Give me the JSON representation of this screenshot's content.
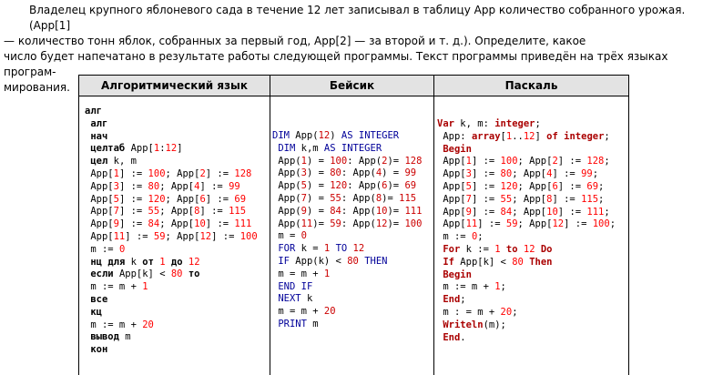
{
  "intro": {
    "line1": "Владелец крупного яблоневого сада в течение 12 лет записывал в таблицу App количество собранного урожая. (App[1]",
    "line2": "— количество тонн яблок, собранных за первый год, App[2] — за второй и т. д.). Определите, какое",
    "line3": "число будет напечатано в результате работы следующей программы. Текст программы приведён на трёх языках програм-",
    "line4": "мирования."
  },
  "table": {
    "headers": [
      "Алгоритмический язык",
      "Бейсик",
      "Паскаль"
    ],
    "algorithmic": [
      "алг",
      " алг",
      " нач",
      " целтаб App[1:12]",
      " цел k, m",
      " App[1] := 100; App[2] := 128",
      " App[3] := 80; App[4] := 99",
      " App[5] := 120; App[6] := 69",
      " App[7] := 55; App[8] := 115",
      " App[9] := 84; App[10] := 111",
      " App[11] := 59; App[12] := 100",
      " m := 0",
      " нц для k от 1 до 12",
      " если App[k] < 80 то",
      " m := m + 1",
      " все",
      " кц",
      " m := m + 20",
      " вывод m",
      " кон"
    ],
    "basic": [
      "DIM App(12) AS INTEGER",
      " DIM k,m AS INTEGER",
      " App(1) = 100: App(2)= 128",
      " App(3) = 80: App(4) = 99",
      " App(5) = 120: App(6)= 69",
      " App(7) = 55: App(8)= 115",
      " App(9) = 84: App(10)= 111",
      " App(11)= 59: App(12)= 100",
      " m = 0",
      " FOR k = 1 TO 12",
      " IF App(k) < 80 THEN",
      " m = m + 1",
      " END IF",
      " NEXT k",
      " m = m + 20",
      " PRINT m"
    ],
    "pascal": [
      "Var k, m: integer;",
      " App: array[1..12] of integer;",
      " Begin",
      " App[1] := 100; App[2] := 128;",
      " App[3] := 80; App[4] := 99;",
      " App[5] := 120; App[6] := 69;",
      " App[7] := 55; App[8] := 115;",
      " App[9] := 84; App[10] := 111;",
      " App[11] := 59; App[12] := 100;",
      " m := 0;",
      " For k := 1 to 12 Do",
      " If App[k] < 80 Then",
      " Begin",
      " m := m + 1;",
      " End;",
      " m : = m + 20;",
      " Writeln(m);",
      " End."
    ]
  }
}
